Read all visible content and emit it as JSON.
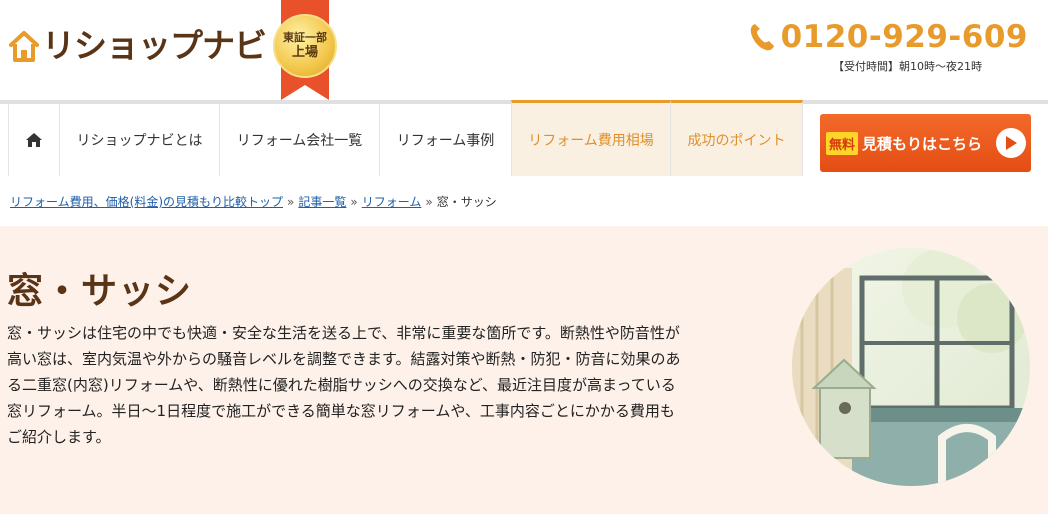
{
  "header": {
    "logo_text": "リショップナビ",
    "badge_line1": "東証一部",
    "badge_line2": "上場",
    "phone_number": "0120-929-609",
    "phone_hours": "【受付時間】朝10時～夜21時"
  },
  "nav": {
    "items": [
      {
        "label": "リショップナビとは"
      },
      {
        "label": "リフォーム会社一覧"
      },
      {
        "label": "リフォーム事例"
      },
      {
        "label": "リフォーム費用相場"
      },
      {
        "label": "成功のポイント"
      }
    ],
    "cta_free": "無料",
    "cta_label": "見積もりはこちら"
  },
  "breadcrumb": {
    "items": [
      {
        "label": "リフォーム費用、価格(料金)の見積もり比較トップ"
      },
      {
        "label": "記事一覧"
      },
      {
        "label": "リフォーム"
      }
    ],
    "current": "窓・サッシ",
    "separator": "»"
  },
  "hero": {
    "title": "窓・サッシ",
    "description": "窓・サッシは住宅の中でも快適・安全な生活を送る上で、非常に重要な箇所です。断熱性や防音性が高い窓は、室内気温や外からの騒音レベルを調整できます。結露対策や断熱・防犯・防音に効果のある二重窓(内窓)リフォームや、断熱性に優れた樹脂サッシへの交換など、最近注目度が高まっている窓リフォーム。半日～1日程度で施工ができる簡単な窓リフォームや、工事内容ごとにかかる費用もご紹介します。"
  },
  "colors": {
    "brand_brown": "#5a3416",
    "accent_orange": "#e89a2a",
    "cta_red": "#e44d14",
    "link_blue": "#1f5fa8",
    "hero_bg": "#fdf1ea"
  }
}
